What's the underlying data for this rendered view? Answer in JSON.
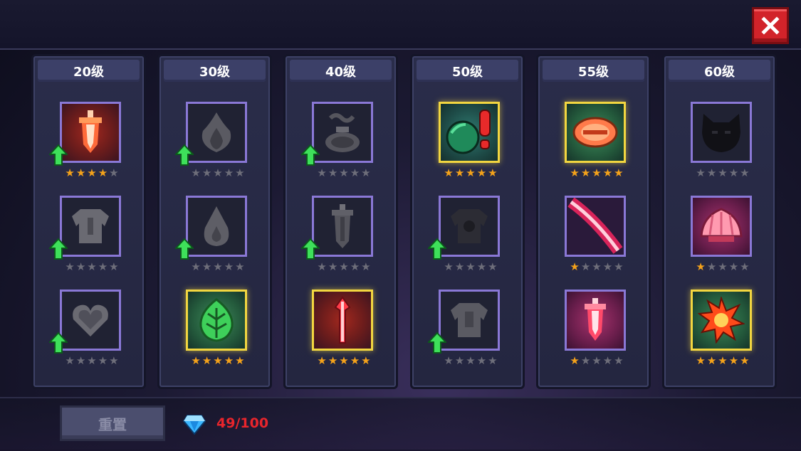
{
  "close_icon": "close-icon",
  "columns": [
    {
      "label": "20级",
      "slots": [
        {
          "icon": "red-crystal-sword-icon",
          "stars": 4,
          "upgrade": true
        },
        {
          "icon": "gray-armor-icon",
          "stars": 0,
          "upgrade": true
        },
        {
          "icon": "gray-heart-icon",
          "stars": 0,
          "upgrade": true
        }
      ]
    },
    {
      "label": "30级",
      "slots": [
        {
          "icon": "gray-flame-icon",
          "stars": 0,
          "upgrade": true
        },
        {
          "icon": "gray-drop-icon",
          "stars": 0,
          "upgrade": true
        },
        {
          "icon": "green-leaf-icon",
          "stars": 5,
          "upgrade": false
        }
      ]
    },
    {
      "label": "40级",
      "slots": [
        {
          "icon": "gray-poison-potion-icon",
          "stars": 0,
          "upgrade": true
        },
        {
          "icon": "gray-sword-icon",
          "stars": 0,
          "upgrade": true
        },
        {
          "icon": "red-spear-icon",
          "stars": 5,
          "upgrade": false
        }
      ]
    },
    {
      "label": "50级",
      "slots": [
        {
          "icon": "green-bomb-alert-icon",
          "stars": 5,
          "upgrade": false
        },
        {
          "icon": "dark-armor-icon",
          "stars": 0,
          "upgrade": true
        },
        {
          "icon": "gray-armor-icon",
          "stars": 0,
          "upgrade": true
        }
      ]
    },
    {
      "label": "55级",
      "slots": [
        {
          "icon": "orange-eye-icon",
          "stars": 5,
          "upgrade": false
        },
        {
          "icon": "crimson-slash-icon",
          "stars": 1,
          "upgrade": false
        },
        {
          "icon": "pink-crystal-sword-icon",
          "stars": 1,
          "upgrade": false
        }
      ]
    },
    {
      "label": "60级",
      "slots": [
        {
          "icon": "shadow-beast-icon",
          "stars": 0,
          "upgrade": false
        },
        {
          "icon": "pink-shell-icon",
          "stars": 1,
          "upgrade": false
        },
        {
          "icon": "red-sun-icon",
          "stars": 5,
          "upgrade": false
        }
      ]
    }
  ],
  "reset_label": "重置",
  "gem_icon": "blue-diamond-icon",
  "gem_count": "49/100",
  "colors": {
    "gem_count": "#e8252c",
    "star_on": "#f4a21a",
    "star_off": "#6e6e7a",
    "tile_border": "#8a78d6",
    "tile_gold": "#f2d640"
  }
}
